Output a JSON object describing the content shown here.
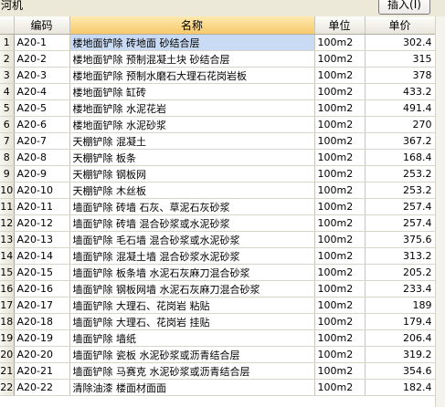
{
  "toolbar": {
    "left_label": "河机",
    "insert_button": "插入(I)"
  },
  "table": {
    "headers": [
      "",
      "编码",
      "名称",
      "单位",
      "单价"
    ],
    "rows": [
      {
        "n": "1",
        "code": "A20-1",
        "name": "楼地面铲除 砖地面 砂结合层",
        "unit": "100m2",
        "price": "302.4"
      },
      {
        "n": "2",
        "code": "A20-2",
        "name": "楼地面铲除 预制混凝土块 砂结合层",
        "unit": "100m2",
        "price": "315"
      },
      {
        "n": "3",
        "code": "A20-3",
        "name": "楼地面铲除 预制水磨石大理石花岗岩板",
        "unit": "100m2",
        "price": "378"
      },
      {
        "n": "4",
        "code": "A20-4",
        "name": "楼地面铲除 缸砖",
        "unit": "100m2",
        "price": "433.2"
      },
      {
        "n": "5",
        "code": "A20-5",
        "name": "楼地面铲除 水泥花岩",
        "unit": "100m2",
        "price": "491.4"
      },
      {
        "n": "6",
        "code": "A20-6",
        "name": "楼地面铲除 水泥砂浆",
        "unit": "100m2",
        "price": "270"
      },
      {
        "n": "7",
        "code": "A20-7",
        "name": "天棚铲除 混凝土",
        "unit": "100m2",
        "price": "367.2"
      },
      {
        "n": "8",
        "code": "A20-8",
        "name": "天棚铲除 板条",
        "unit": "100m2",
        "price": "168.4"
      },
      {
        "n": "9",
        "code": "A20-9",
        "name": "天棚铲除 钢板网",
        "unit": "100m2",
        "price": "253.2"
      },
      {
        "n": "10",
        "code": "A20-10",
        "name": "天棚铲除 木丝板",
        "unit": "100m2",
        "price": "253.2"
      },
      {
        "n": "11",
        "code": "A20-11",
        "name": "墙面铲除 砖墙 石灰、草泥石灰砂浆",
        "unit": "100m2",
        "price": "257.4"
      },
      {
        "n": "12",
        "code": "A20-12",
        "name": "墙面铲除 砖墙 混合砂浆或水泥砂浆",
        "unit": "100m2",
        "price": "257.4"
      },
      {
        "n": "13",
        "code": "A20-13",
        "name": "墙面铲除 毛石墙 混合砂浆或水泥砂浆",
        "unit": "100m2",
        "price": "375.6"
      },
      {
        "n": "14",
        "code": "A20-14",
        "name": "墙面铲除 混凝土墙 混合砂浆水泥砂浆",
        "unit": "100m2",
        "price": "313.2"
      },
      {
        "n": "15",
        "code": "A20-15",
        "name": "墙面铲除 板条墙 水泥石灰麻刀混合砂浆",
        "unit": "100m2",
        "price": "205.2"
      },
      {
        "n": "16",
        "code": "A20-16",
        "name": "墙面铲除 钢板网墙 水泥石灰麻刀混合砂浆",
        "unit": "100m2",
        "price": "233.4"
      },
      {
        "n": "17",
        "code": "A20-17",
        "name": "墙面铲除 大理石、花岗岩 粘贴",
        "unit": "100m2",
        "price": "189"
      },
      {
        "n": "18",
        "code": "A20-18",
        "name": "墙面铲除 大理石、花岗岩 挂贴",
        "unit": "100m2",
        "price": "179.4"
      },
      {
        "n": "19",
        "code": "A20-19",
        "name": "墙面铲除 墙纸",
        "unit": "100m2",
        "price": "206.4"
      },
      {
        "n": "20",
        "code": "A20-20",
        "name": "墙面铲除 瓷板 水泥砂浆或沥青结合层",
        "unit": "100m2",
        "price": "319.2"
      },
      {
        "n": "21",
        "code": "A20-21",
        "name": "墙面铲除 马赛克 水泥砂浆或沥青结合层",
        "unit": "100m2",
        "price": "354.6"
      },
      {
        "n": "22",
        "code": "A20-22",
        "name": "清除油漆 楼面材面面",
        "unit": "100m2",
        "price": "182.4"
      }
    ]
  }
}
